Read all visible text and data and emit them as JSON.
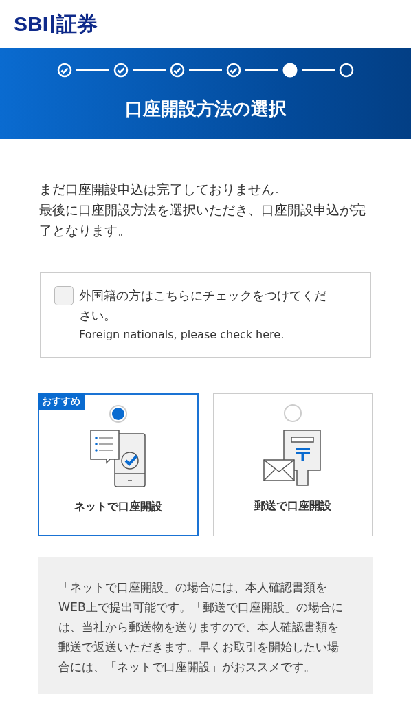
{
  "logo": {
    "latin": "SBI",
    "kanji": "証券"
  },
  "steps": [
    {
      "kind": "done"
    },
    {
      "kind": "done"
    },
    {
      "kind": "done"
    },
    {
      "kind": "done"
    },
    {
      "kind": "current"
    },
    {
      "kind": "todo"
    }
  ],
  "page_title": "口座開設方法の選択",
  "intro": [
    "まだ口座開設申込は完了しておりません。",
    "最後に口座開設方法を選択いただき、口座開設申込が完了となります。"
  ],
  "foreign_check": {
    "checked": false,
    "label": "外国籍の方はこちらにチェックをつけてください。",
    "label_en": "Foreign nationals, please check here."
  },
  "options": [
    {
      "kind": "net",
      "label": "ネットで口座開設",
      "badge": "おすすめ",
      "selected": true
    },
    {
      "kind": "mail",
      "label": "郵送で口座開設",
      "selected": false
    }
  ],
  "note": "「ネットで口座開設」の場合には、本人確認書類をWEB上で提出可能です。「郵送で口座開設」の場合には、当社から郵送物を送りますので、本人確認書類を郵送で返送いただきます。早くお取引を開始したい場合には、「ネットで口座開設」がおススメです。"
}
